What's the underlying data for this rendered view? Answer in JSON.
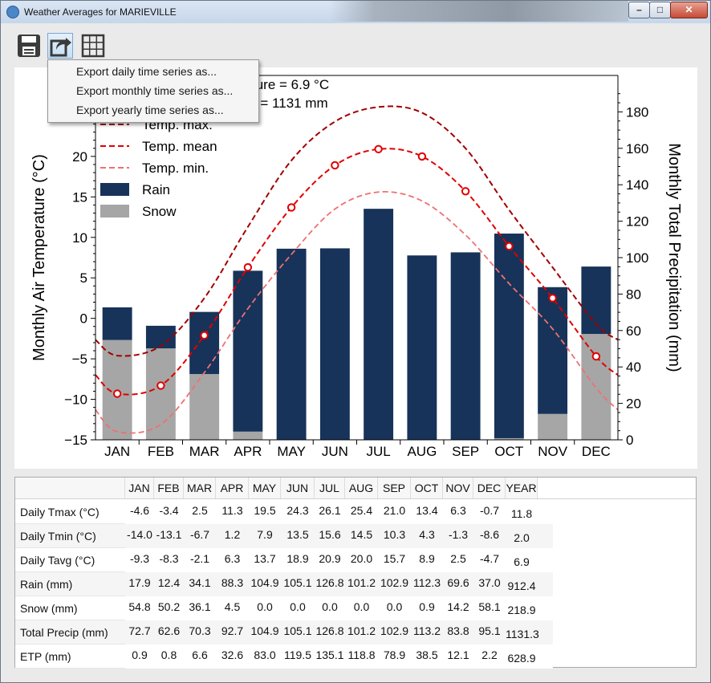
{
  "window": {
    "title": "Weather Averages for MARIEVILLE"
  },
  "titlebar_buttons": {
    "minimize": "–",
    "maximize": "□",
    "close": "✕"
  },
  "toolbar": {
    "save": {
      "icon": "save-icon"
    },
    "export": {
      "icon": "export-icon"
    },
    "table": {
      "icon": "grid-icon"
    }
  },
  "export_menu": {
    "items": [
      "Export daily time series as...",
      "Export monthly time series as...",
      "Export yearly time series as..."
    ]
  },
  "chart_data": {
    "type": "bar",
    "annotations": [
      "Mean annual air temperature = 6.9 °C",
      "Mean annual precipitation = 1131 mm"
    ],
    "categories": [
      "JAN",
      "FEB",
      "MAR",
      "APR",
      "MAY",
      "JUN",
      "JUL",
      "AUG",
      "SEP",
      "OCT",
      "NOV",
      "DEC"
    ],
    "ylabel": "Monthly Air Temperature (°C)",
    "y2label": "Monthly Total Precipitation (mm)",
    "ylim": [
      -15,
      30
    ],
    "y2lim": [
      0,
      200
    ],
    "yticks": [
      -15,
      -10,
      -5,
      0,
      5,
      10,
      15,
      20,
      25
    ],
    "y2ticks": [
      0,
      20,
      40,
      60,
      80,
      100,
      120,
      140,
      160,
      180
    ],
    "grid": false,
    "legend_position": "top-left",
    "series": [
      {
        "name": "Temp. max.",
        "kind": "line",
        "color": "#a00000",
        "values": [
          -4.6,
          -3.4,
          2.5,
          11.3,
          19.5,
          24.3,
          26.1,
          25.4,
          21.0,
          13.4,
          6.3,
          -0.7
        ]
      },
      {
        "name": "Temp. mean",
        "kind": "line",
        "color": "#e00000",
        "markers": true,
        "values": [
          -9.3,
          -8.3,
          -2.1,
          6.3,
          13.7,
          18.9,
          20.9,
          20.0,
          15.7,
          8.9,
          2.5,
          -4.7
        ]
      },
      {
        "name": "Temp. min.",
        "kind": "line",
        "color": "#f07070",
        "values": [
          -14.0,
          -13.1,
          -6.7,
          1.2,
          7.9,
          13.5,
          15.6,
          14.5,
          10.3,
          4.3,
          -1.3,
          -8.6
        ]
      },
      {
        "name": "Rain",
        "kind": "bar",
        "axis": "right",
        "color": "#173359",
        "values": [
          17.9,
          12.4,
          34.1,
          88.3,
          104.9,
          105.1,
          126.8,
          101.2,
          102.9,
          112.3,
          69.6,
          37.0
        ]
      },
      {
        "name": "Snow",
        "kind": "bar",
        "axis": "right",
        "color": "#a6a6a6",
        "values": [
          54.8,
          50.2,
          36.1,
          4.5,
          0.0,
          0.0,
          0.0,
          0.0,
          0.0,
          0.9,
          14.2,
          58.1
        ]
      }
    ]
  },
  "table": {
    "columns": [
      "JAN",
      "FEB",
      "MAR",
      "APR",
      "MAY",
      "JUN",
      "JUL",
      "AUG",
      "SEP",
      "OCT",
      "NOV",
      "DEC",
      "YEAR"
    ],
    "rows": [
      {
        "label": "Daily Tmax (°C)",
        "values": [
          "-4.6",
          "-3.4",
          "2.5",
          "11.3",
          "19.5",
          "24.3",
          "26.1",
          "25.4",
          "21.0",
          "13.4",
          "6.3",
          "-0.7",
          "11.8"
        ]
      },
      {
        "label": "Daily Tmin (°C)",
        "values": [
          "-14.0",
          "-13.1",
          "-6.7",
          "1.2",
          "7.9",
          "13.5",
          "15.6",
          "14.5",
          "10.3",
          "4.3",
          "-1.3",
          "-8.6",
          "2.0"
        ]
      },
      {
        "label": "Daily Tavg (°C)",
        "values": [
          "-9.3",
          "-8.3",
          "-2.1",
          "6.3",
          "13.7",
          "18.9",
          "20.9",
          "20.0",
          "15.7",
          "8.9",
          "2.5",
          "-4.7",
          "6.9"
        ]
      },
      {
        "label": "Rain (mm)",
        "values": [
          "17.9",
          "12.4",
          "34.1",
          "88.3",
          "104.9",
          "105.1",
          "126.8",
          "101.2",
          "102.9",
          "112.3",
          "69.6",
          "37.0",
          "912.4"
        ]
      },
      {
        "label": "Snow (mm)",
        "values": [
          "54.8",
          "50.2",
          "36.1",
          "4.5",
          "0.0",
          "0.0",
          "0.0",
          "0.0",
          "0.0",
          "0.9",
          "14.2",
          "58.1",
          "218.9"
        ]
      },
      {
        "label": "Total Precip (mm)",
        "values": [
          "72.7",
          "62.6",
          "70.3",
          "92.7",
          "104.9",
          "105.1",
          "126.8",
          "101.2",
          "102.9",
          "113.2",
          "83.8",
          "95.1",
          "1131.3"
        ]
      },
      {
        "label": "ETP (mm)",
        "values": [
          "0.9",
          "0.8",
          "6.6",
          "32.6",
          "83.0",
          "119.5",
          "135.1",
          "118.8",
          "78.9",
          "38.5",
          "12.1",
          "2.2",
          "628.9"
        ]
      }
    ]
  }
}
